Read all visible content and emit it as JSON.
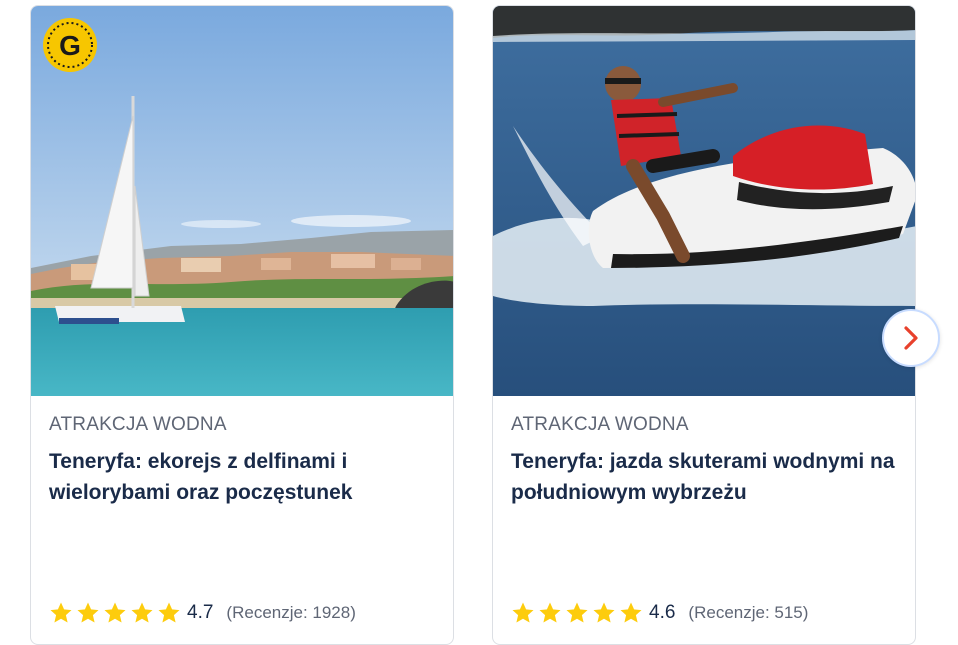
{
  "cards": [
    {
      "category": "ATRAKCJA WODNA",
      "title": "Teneryfa: ekorejs z delfinami i wielorybami oraz poczęstunek",
      "score": "4.7",
      "reviews": "(Recenzje: 1928)",
      "stars": 5,
      "image_icon": "catamaran-photo"
    },
    {
      "category": "ATRAKCJA WODNA",
      "title": "Teneryfa: jazda skuterami wodnymi na południowym wybrzeżu",
      "score": "4.6",
      "reviews": "(Recenzje: 515)",
      "stars": 5,
      "image_icon": "jet-ski-photo"
    }
  ],
  "badge": {
    "letter": "G",
    "icon": "getyourguide-badge-icon"
  },
  "navigation": {
    "next_icon": "chevron-right-icon"
  },
  "colors": {
    "star": "#fdcc0d",
    "title": "#1a2b49",
    "category": "#5f6675",
    "chevron": "#e8412c"
  }
}
